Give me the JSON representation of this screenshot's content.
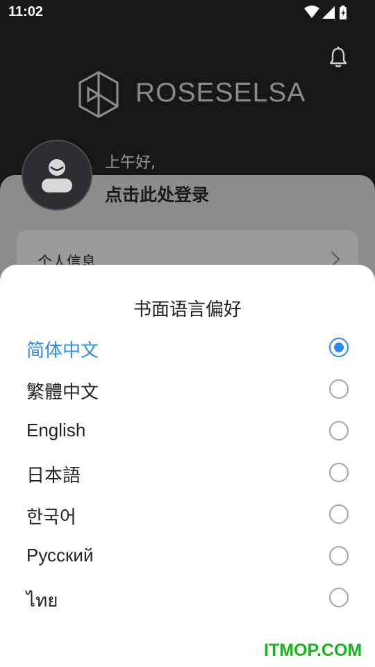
{
  "status_bar": {
    "time": "11:02"
  },
  "brand": {
    "name": "ROSESELSA"
  },
  "user": {
    "greeting": "上午好,",
    "login_prompt": "点击此处登录"
  },
  "menu": {
    "personal_info": "个人信息"
  },
  "language_sheet": {
    "title": "书面语言偏好",
    "options": [
      {
        "label": "简体中文",
        "selected": true
      },
      {
        "label": "繁體中文",
        "selected": false
      },
      {
        "label": "English",
        "selected": false
      },
      {
        "label": "日本語",
        "selected": false
      },
      {
        "label": "한국어",
        "selected": false
      },
      {
        "label": "Русский",
        "selected": false
      },
      {
        "label": "ไทย",
        "selected": false
      }
    ]
  },
  "watermark": "ITMOP.COM",
  "colors": {
    "accent": "#2a8cf0",
    "watermark": "#17b41a"
  }
}
